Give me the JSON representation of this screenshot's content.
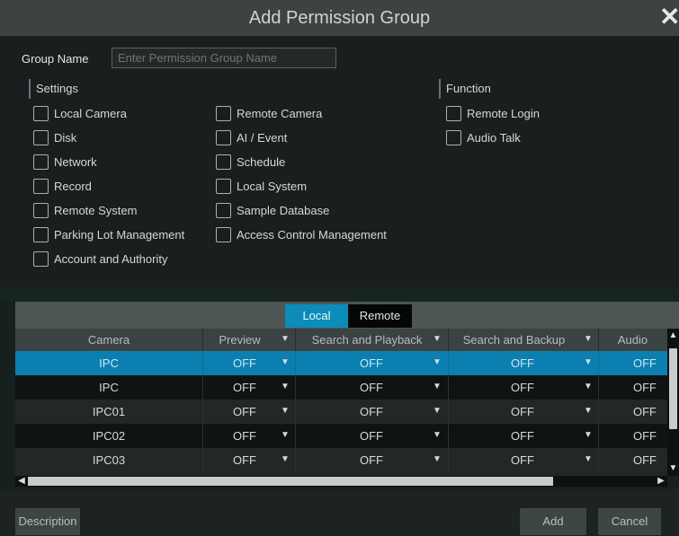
{
  "dialog": {
    "title": "Add Permission Group"
  },
  "group_name": {
    "label": "Group Name",
    "placeholder": "Enter Permission Group Name",
    "value": ""
  },
  "settings": {
    "title": "Settings",
    "items": [
      {
        "label": "Local Camera"
      },
      {
        "label": "Disk"
      },
      {
        "label": "Network"
      },
      {
        "label": "Record"
      },
      {
        "label": "Remote System"
      },
      {
        "label": "Parking Lot Management"
      },
      {
        "label": "Account and Authority"
      },
      {
        "label": "Remote Camera"
      },
      {
        "label": "AI / Event"
      },
      {
        "label": "Schedule"
      },
      {
        "label": "Local System"
      },
      {
        "label": "Sample Database"
      },
      {
        "label": "Access Control Management"
      }
    ]
  },
  "function": {
    "title": "Function",
    "items": [
      {
        "label": "Remote Login"
      },
      {
        "label": "Audio Talk"
      }
    ]
  },
  "tabs": [
    {
      "label": "Local",
      "active": true
    },
    {
      "label": "Remote",
      "active": false
    }
  ],
  "table": {
    "columns": [
      "Camera",
      "Preview",
      "Search and Playback",
      "Search and Backup",
      "Audio"
    ],
    "rows": [
      {
        "camera": "IPC",
        "preview": "OFF",
        "playback": "OFF",
        "backup": "OFF",
        "audio": "OFF",
        "selected": true
      },
      {
        "camera": "IPC",
        "preview": "OFF",
        "playback": "OFF",
        "backup": "OFF",
        "audio": "OFF"
      },
      {
        "camera": "IPC01",
        "preview": "OFF",
        "playback": "OFF",
        "backup": "OFF",
        "audio": "OFF"
      },
      {
        "camera": "IPC02",
        "preview": "OFF",
        "playback": "OFF",
        "backup": "OFF",
        "audio": "OFF"
      },
      {
        "camera": "IPC03",
        "preview": "OFF",
        "playback": "OFF",
        "backup": "OFF",
        "audio": "OFF"
      }
    ]
  },
  "buttons": {
    "description": "Description",
    "add": "Add",
    "cancel": "Cancel"
  },
  "colors": {
    "accent": "#0a7fb0",
    "tab_active": "#0c8cba"
  },
  "icons": {
    "close": "close-icon",
    "dropdown": "chevron-down-icon"
  }
}
